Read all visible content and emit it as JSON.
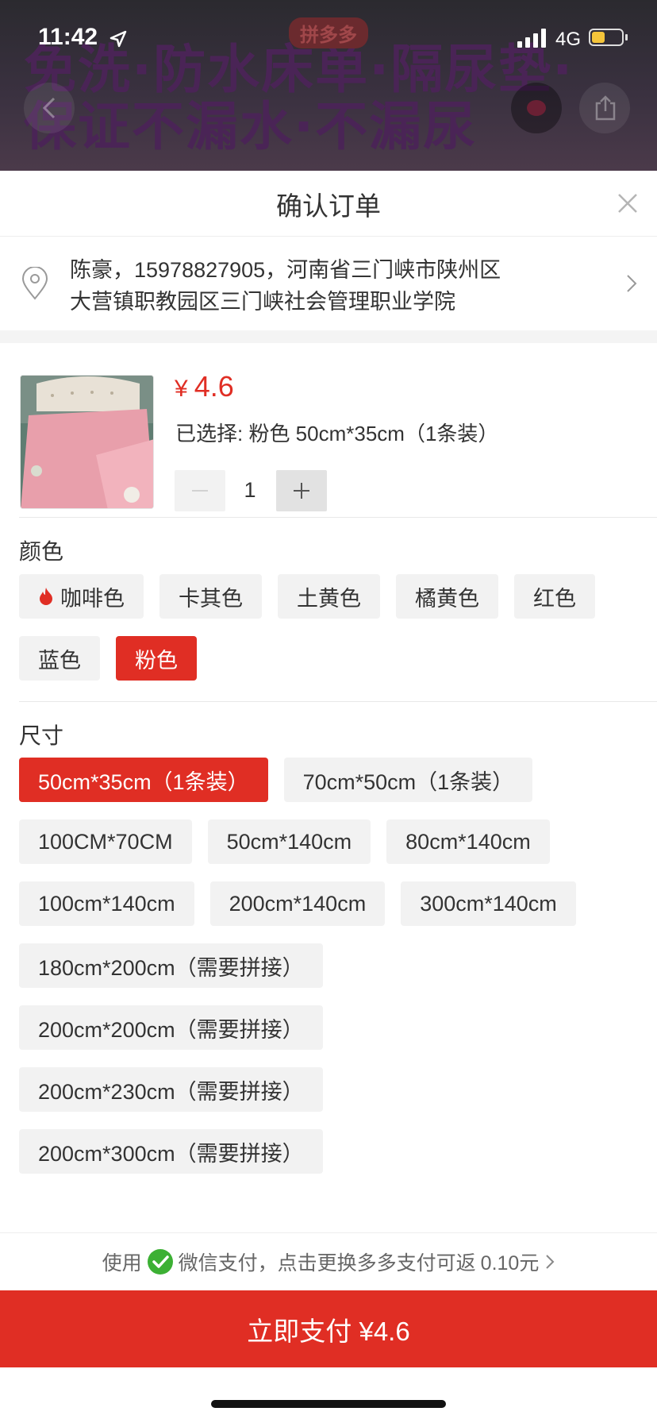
{
  "status_bar": {
    "time": "11:42",
    "network": "4G",
    "battery_level": 0.45
  },
  "background": {
    "brand_badge": "拼多多",
    "banner_line1": "免洗·防水床单·隔尿垫·",
    "banner_line2": "保证不漏水·不漏尿"
  },
  "sheet": {
    "title": "确认订单"
  },
  "address": {
    "line1": "陈豪，15978827905，河南省三门峡市陕州区",
    "line2": "大营镇职教园区三门峡社会管理职业学院"
  },
  "product": {
    "price_symbol": "¥",
    "price": "4.6",
    "selected_label": "已选择: 粉色 50cm*35cm（1条装）",
    "quantity": "1"
  },
  "color_section": {
    "title": "颜色",
    "options": [
      "咖啡色",
      "卡其色",
      "土黄色",
      "橘黄色",
      "红色",
      "蓝色",
      "粉色"
    ],
    "selected": "粉色"
  },
  "size_section": {
    "title": "尺寸",
    "options": [
      "50cm*35cm（1条装）",
      "70cm*50cm（1条装）",
      "100CM*70CM",
      "50cm*140cm",
      "80cm*140cm",
      "100cm*140cm",
      "200cm*140cm",
      "300cm*140cm",
      "180cm*200cm（需要拼接）",
      "200cm*200cm（需要拼接）",
      "200cm*230cm（需要拼接）",
      "200cm*300cm（需要拼接）"
    ],
    "selected": "50cm*35cm（1条装）"
  },
  "payment": {
    "prefix": "使用",
    "method": "微信支付，点击更换多多支付可返",
    "rebate": "0.10元",
    "button_label": "立即支付 ¥4.6"
  },
  "colors": {
    "accent": "#e02e24",
    "chip_bg": "#f2f2f2",
    "wechat_green": "#3cb034"
  }
}
